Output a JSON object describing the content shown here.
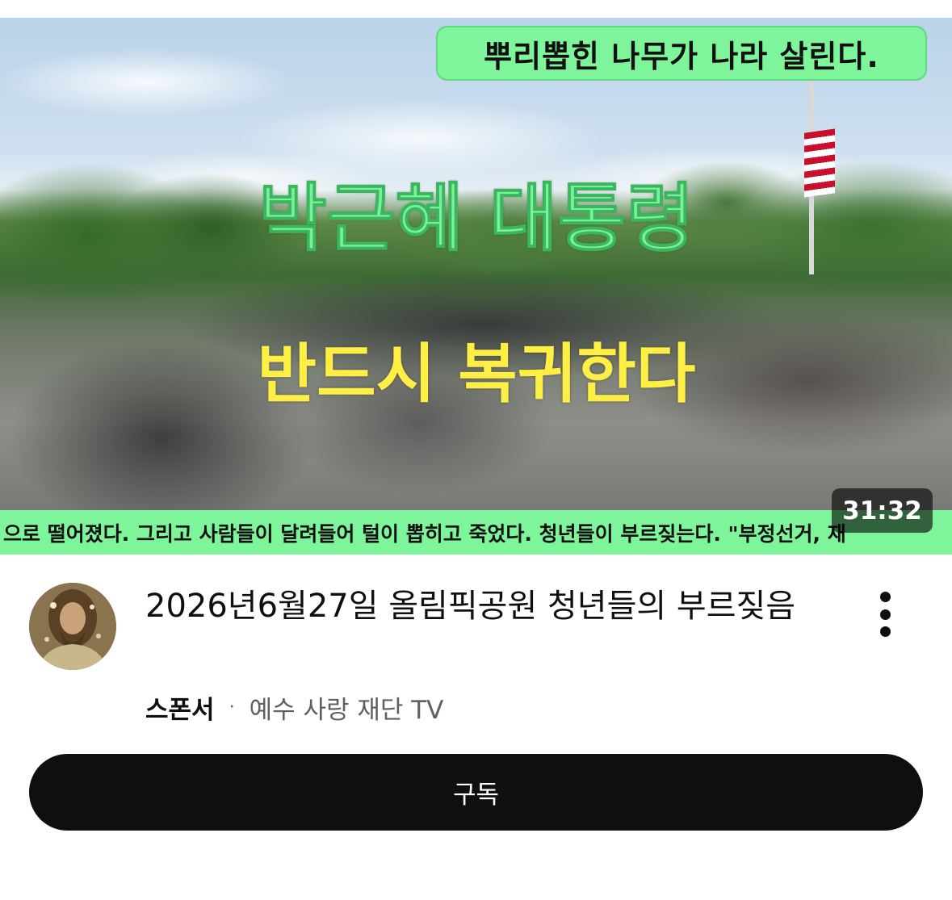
{
  "video": {
    "thumbnail": {
      "top_banner": "뿌리뽑힌 나무가 나라 살린다.",
      "headline_green": "박근혜 대통령",
      "headline_yellow": "반드시 복귀한다",
      "ticker": "으로 떨어졌다. 그리고 사람들이 달려들어 털이 뽑히고 죽었다.  청년들이 부르짖는다. \"부정선거, 재",
      "duration": "31:32",
      "colors": {
        "banner_green": "#7ef59a",
        "headline_green": "#79f09a",
        "headline_yellow": "#ffee44"
      }
    },
    "title": "2026년6월27일 올림픽공원 청년들의 부르짖음",
    "meta": {
      "sponsor_label": "스폰서",
      "separator": "·",
      "channel_name": "예수 사랑 재단 TV"
    },
    "menu_icon": "kebab-menu-icon",
    "avatar_icon": "channel-avatar"
  },
  "actions": {
    "subscribe_label": "구독",
    "subscribe_color": "#0f0f0f"
  }
}
